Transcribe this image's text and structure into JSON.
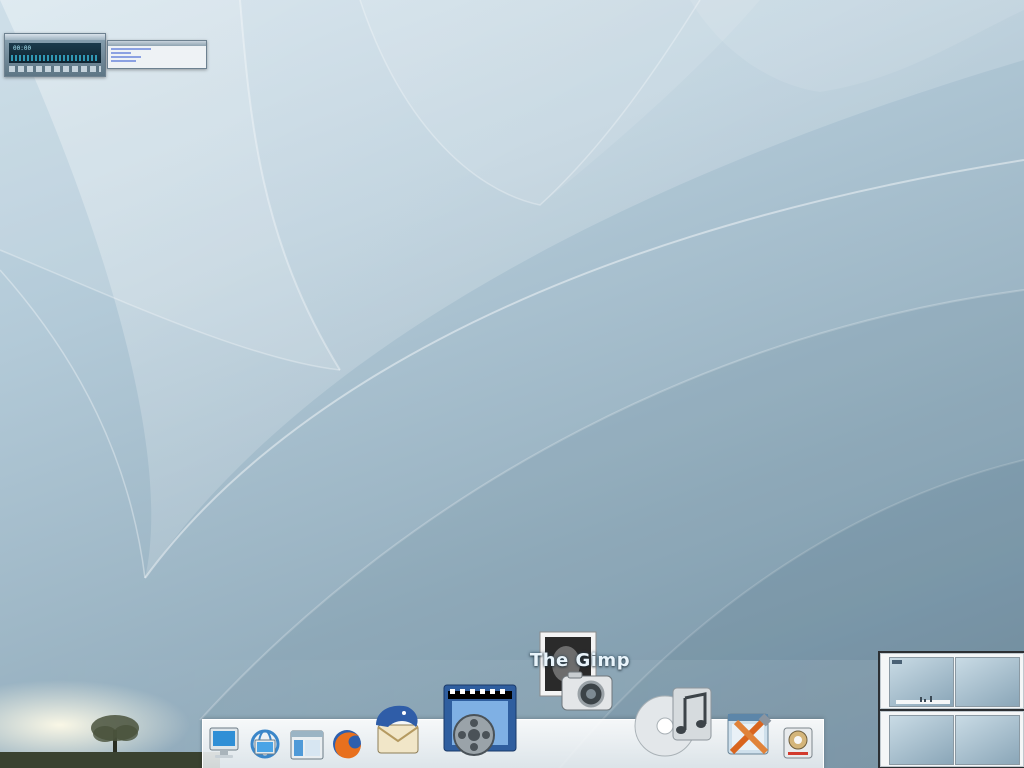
{
  "desktop": {
    "wallpaper": "abstract-blue-curves-wallpaper"
  },
  "mini_windows": [
    {
      "name": "media-player-window",
      "time": "00:00"
    },
    {
      "name": "text-editor-window"
    }
  ],
  "dock": {
    "hover_label": "The Gimp",
    "items": [
      {
        "name": "computer-icon"
      },
      {
        "name": "network-icon"
      },
      {
        "name": "file-manager-icon"
      },
      {
        "name": "firefox-icon"
      },
      {
        "name": "thunderbird-icon"
      },
      {
        "name": "video-player-icon"
      },
      {
        "name": "gimp-icon"
      },
      {
        "name": "music-player-icon"
      },
      {
        "name": "settings-tools-icon"
      },
      {
        "name": "disk-drive-icon"
      }
    ]
  },
  "pager": {
    "workspaces": 4
  },
  "colors": {
    "wallpaper_light": "#c8dbe6",
    "wallpaper_dark": "#7892a4",
    "dock_label": "#e9f4fb",
    "pager_bg": "#2b2f33"
  }
}
